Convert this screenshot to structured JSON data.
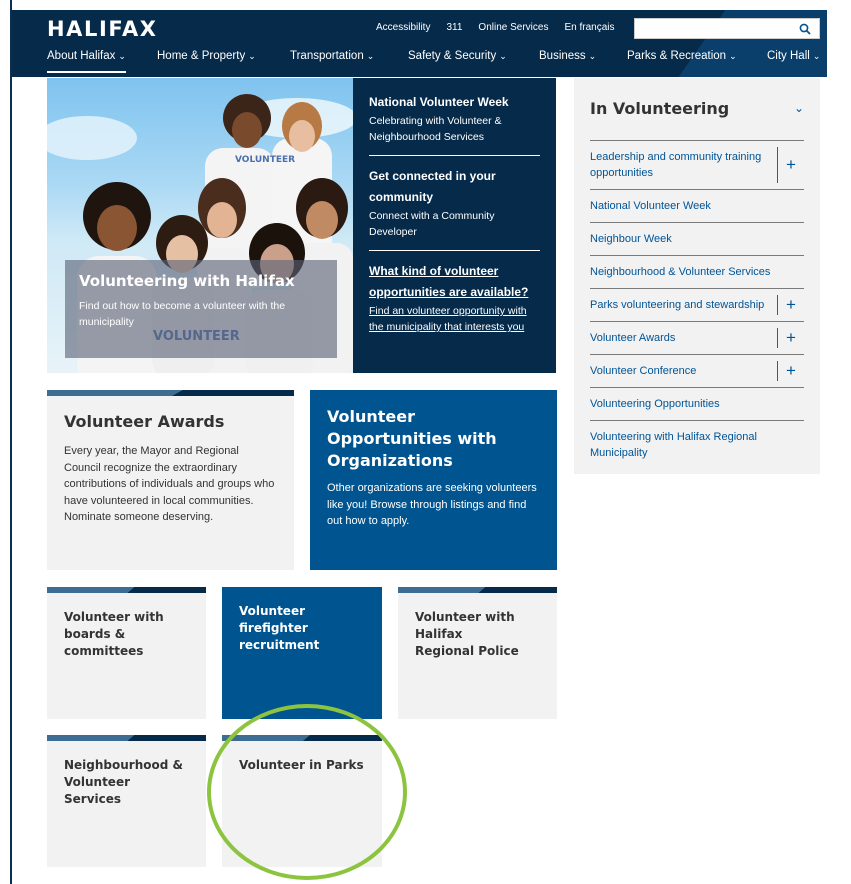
{
  "header": {
    "logo": "HALIFAX",
    "utility": [
      "Accessibility",
      "311",
      "Online Services",
      "En français"
    ],
    "search_placeholder": "",
    "nav": [
      "About Halifax",
      "Home & Property",
      "Transportation",
      "Safety & Security",
      "Business",
      "Parks & Recreation",
      "City Hall"
    ]
  },
  "hero": {
    "caption_title": "Volunteering with Halifax",
    "caption_text": "Find out how to become a volunteer with the municipality",
    "panel": [
      {
        "title": "National Volunteer Week",
        "text": "Celebrating with Volunteer & Neighbourhood Services"
      },
      {
        "title": "Get connected in your community",
        "text": "Connect with a Community Developer"
      },
      {
        "title": "What kind of volunteer opportunities are available?",
        "text": "Find an volunteer opportunity with the municipality that interests you"
      }
    ]
  },
  "sidebar": {
    "title": "In Volunteering",
    "items": [
      "Leadership and community training opportunities",
      "National Volunteer Week",
      "Neighbour Week",
      "Neighbourhood & Volunteer Services",
      "Parks volunteering and stewardship",
      "Volunteer Awards",
      "Volunteer Conference",
      "Volunteering Opportunities",
      "Volunteering with Halifax Regional Municipality"
    ]
  },
  "cards": {
    "awards_title": "Volunteer Awards",
    "awards_text": "Every year, the Mayor and Regional Council recognize the extraordinary contributions of individuals and groups who have volunteered in local communities. Nominate someone deserving.",
    "orgs_title": "Volunteer Opportunities with Organizations",
    "orgs_text": "Other organizations are seeking volunteers like you! Browse through listings and find out how to apply.",
    "boards": "Volunteer with boards & committees",
    "firefighter": "Volunteer firefighter recruitment",
    "police": "Volunteer with Halifax Regional Police",
    "neighbourhood": "Neighbourhood & Volunteer Services",
    "parks": "Volunteer in Parks"
  },
  "photo_shirt_text": "VOLUNTEER",
  "colors": {
    "navy": "#062a4a",
    "blue": "#00548f",
    "link": "#005496",
    "highlight_ring": "#8cc43f"
  }
}
